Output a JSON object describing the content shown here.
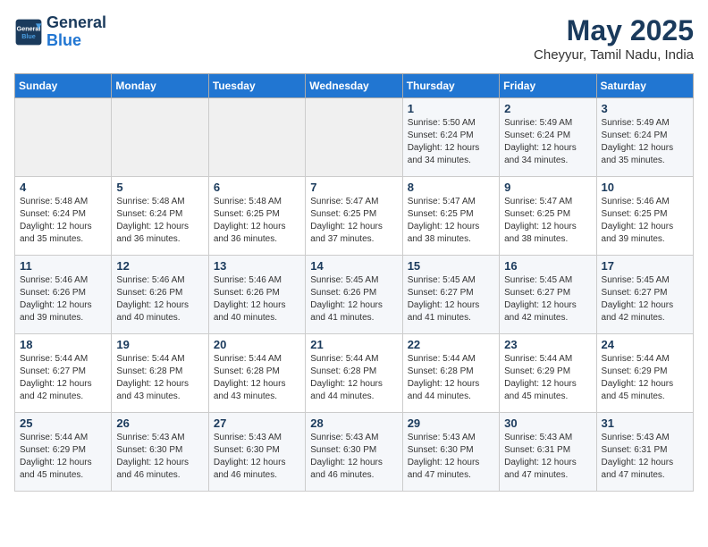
{
  "header": {
    "logo_line1": "General",
    "logo_line2": "Blue",
    "month_title": "May 2025",
    "location": "Cheyyur, Tamil Nadu, India"
  },
  "weekdays": [
    "Sunday",
    "Monday",
    "Tuesday",
    "Wednesday",
    "Thursday",
    "Friday",
    "Saturday"
  ],
  "weeks": [
    [
      {
        "day": "",
        "info": ""
      },
      {
        "day": "",
        "info": ""
      },
      {
        "day": "",
        "info": ""
      },
      {
        "day": "",
        "info": ""
      },
      {
        "day": "1",
        "info": "Sunrise: 5:50 AM\nSunset: 6:24 PM\nDaylight: 12 hours\nand 34 minutes."
      },
      {
        "day": "2",
        "info": "Sunrise: 5:49 AM\nSunset: 6:24 PM\nDaylight: 12 hours\nand 34 minutes."
      },
      {
        "day": "3",
        "info": "Sunrise: 5:49 AM\nSunset: 6:24 PM\nDaylight: 12 hours\nand 35 minutes."
      }
    ],
    [
      {
        "day": "4",
        "info": "Sunrise: 5:48 AM\nSunset: 6:24 PM\nDaylight: 12 hours\nand 35 minutes."
      },
      {
        "day": "5",
        "info": "Sunrise: 5:48 AM\nSunset: 6:24 PM\nDaylight: 12 hours\nand 36 minutes."
      },
      {
        "day": "6",
        "info": "Sunrise: 5:48 AM\nSunset: 6:25 PM\nDaylight: 12 hours\nand 36 minutes."
      },
      {
        "day": "7",
        "info": "Sunrise: 5:47 AM\nSunset: 6:25 PM\nDaylight: 12 hours\nand 37 minutes."
      },
      {
        "day": "8",
        "info": "Sunrise: 5:47 AM\nSunset: 6:25 PM\nDaylight: 12 hours\nand 38 minutes."
      },
      {
        "day": "9",
        "info": "Sunrise: 5:47 AM\nSunset: 6:25 PM\nDaylight: 12 hours\nand 38 minutes."
      },
      {
        "day": "10",
        "info": "Sunrise: 5:46 AM\nSunset: 6:25 PM\nDaylight: 12 hours\nand 39 minutes."
      }
    ],
    [
      {
        "day": "11",
        "info": "Sunrise: 5:46 AM\nSunset: 6:26 PM\nDaylight: 12 hours\nand 39 minutes."
      },
      {
        "day": "12",
        "info": "Sunrise: 5:46 AM\nSunset: 6:26 PM\nDaylight: 12 hours\nand 40 minutes."
      },
      {
        "day": "13",
        "info": "Sunrise: 5:46 AM\nSunset: 6:26 PM\nDaylight: 12 hours\nand 40 minutes."
      },
      {
        "day": "14",
        "info": "Sunrise: 5:45 AM\nSunset: 6:26 PM\nDaylight: 12 hours\nand 41 minutes."
      },
      {
        "day": "15",
        "info": "Sunrise: 5:45 AM\nSunset: 6:27 PM\nDaylight: 12 hours\nand 41 minutes."
      },
      {
        "day": "16",
        "info": "Sunrise: 5:45 AM\nSunset: 6:27 PM\nDaylight: 12 hours\nand 42 minutes."
      },
      {
        "day": "17",
        "info": "Sunrise: 5:45 AM\nSunset: 6:27 PM\nDaylight: 12 hours\nand 42 minutes."
      }
    ],
    [
      {
        "day": "18",
        "info": "Sunrise: 5:44 AM\nSunset: 6:27 PM\nDaylight: 12 hours\nand 42 minutes."
      },
      {
        "day": "19",
        "info": "Sunrise: 5:44 AM\nSunset: 6:28 PM\nDaylight: 12 hours\nand 43 minutes."
      },
      {
        "day": "20",
        "info": "Sunrise: 5:44 AM\nSunset: 6:28 PM\nDaylight: 12 hours\nand 43 minutes."
      },
      {
        "day": "21",
        "info": "Sunrise: 5:44 AM\nSunset: 6:28 PM\nDaylight: 12 hours\nand 44 minutes."
      },
      {
        "day": "22",
        "info": "Sunrise: 5:44 AM\nSunset: 6:28 PM\nDaylight: 12 hours\nand 44 minutes."
      },
      {
        "day": "23",
        "info": "Sunrise: 5:44 AM\nSunset: 6:29 PM\nDaylight: 12 hours\nand 45 minutes."
      },
      {
        "day": "24",
        "info": "Sunrise: 5:44 AM\nSunset: 6:29 PM\nDaylight: 12 hours\nand 45 minutes."
      }
    ],
    [
      {
        "day": "25",
        "info": "Sunrise: 5:44 AM\nSunset: 6:29 PM\nDaylight: 12 hours\nand 45 minutes."
      },
      {
        "day": "26",
        "info": "Sunrise: 5:43 AM\nSunset: 6:30 PM\nDaylight: 12 hours\nand 46 minutes."
      },
      {
        "day": "27",
        "info": "Sunrise: 5:43 AM\nSunset: 6:30 PM\nDaylight: 12 hours\nand 46 minutes."
      },
      {
        "day": "28",
        "info": "Sunrise: 5:43 AM\nSunset: 6:30 PM\nDaylight: 12 hours\nand 46 minutes."
      },
      {
        "day": "29",
        "info": "Sunrise: 5:43 AM\nSunset: 6:30 PM\nDaylight: 12 hours\nand 47 minutes."
      },
      {
        "day": "30",
        "info": "Sunrise: 5:43 AM\nSunset: 6:31 PM\nDaylight: 12 hours\nand 47 minutes."
      },
      {
        "day": "31",
        "info": "Sunrise: 5:43 AM\nSunset: 6:31 PM\nDaylight: 12 hours\nand 47 minutes."
      }
    ]
  ]
}
